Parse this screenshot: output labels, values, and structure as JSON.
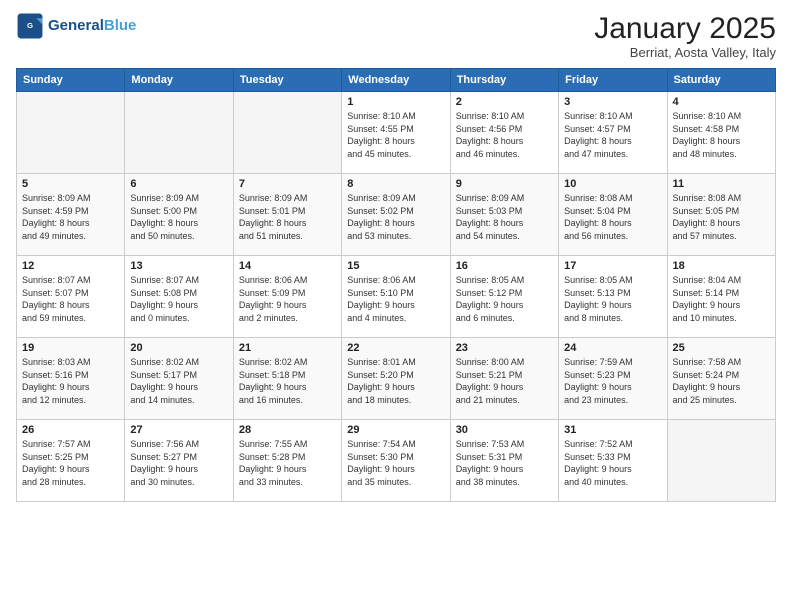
{
  "header": {
    "logo_line1": "General",
    "logo_line2": "Blue",
    "month": "January 2025",
    "location": "Berriat, Aosta Valley, Italy"
  },
  "weekdays": [
    "Sunday",
    "Monday",
    "Tuesday",
    "Wednesday",
    "Thursday",
    "Friday",
    "Saturday"
  ],
  "weeks": [
    [
      {
        "day": "",
        "info": ""
      },
      {
        "day": "",
        "info": ""
      },
      {
        "day": "",
        "info": ""
      },
      {
        "day": "1",
        "info": "Sunrise: 8:10 AM\nSunset: 4:55 PM\nDaylight: 8 hours\nand 45 minutes."
      },
      {
        "day": "2",
        "info": "Sunrise: 8:10 AM\nSunset: 4:56 PM\nDaylight: 8 hours\nand 46 minutes."
      },
      {
        "day": "3",
        "info": "Sunrise: 8:10 AM\nSunset: 4:57 PM\nDaylight: 8 hours\nand 47 minutes."
      },
      {
        "day": "4",
        "info": "Sunrise: 8:10 AM\nSunset: 4:58 PM\nDaylight: 8 hours\nand 48 minutes."
      }
    ],
    [
      {
        "day": "5",
        "info": "Sunrise: 8:09 AM\nSunset: 4:59 PM\nDaylight: 8 hours\nand 49 minutes."
      },
      {
        "day": "6",
        "info": "Sunrise: 8:09 AM\nSunset: 5:00 PM\nDaylight: 8 hours\nand 50 minutes."
      },
      {
        "day": "7",
        "info": "Sunrise: 8:09 AM\nSunset: 5:01 PM\nDaylight: 8 hours\nand 51 minutes."
      },
      {
        "day": "8",
        "info": "Sunrise: 8:09 AM\nSunset: 5:02 PM\nDaylight: 8 hours\nand 53 minutes."
      },
      {
        "day": "9",
        "info": "Sunrise: 8:09 AM\nSunset: 5:03 PM\nDaylight: 8 hours\nand 54 minutes."
      },
      {
        "day": "10",
        "info": "Sunrise: 8:08 AM\nSunset: 5:04 PM\nDaylight: 8 hours\nand 56 minutes."
      },
      {
        "day": "11",
        "info": "Sunrise: 8:08 AM\nSunset: 5:05 PM\nDaylight: 8 hours\nand 57 minutes."
      }
    ],
    [
      {
        "day": "12",
        "info": "Sunrise: 8:07 AM\nSunset: 5:07 PM\nDaylight: 8 hours\nand 59 minutes."
      },
      {
        "day": "13",
        "info": "Sunrise: 8:07 AM\nSunset: 5:08 PM\nDaylight: 9 hours\nand 0 minutes."
      },
      {
        "day": "14",
        "info": "Sunrise: 8:06 AM\nSunset: 5:09 PM\nDaylight: 9 hours\nand 2 minutes."
      },
      {
        "day": "15",
        "info": "Sunrise: 8:06 AM\nSunset: 5:10 PM\nDaylight: 9 hours\nand 4 minutes."
      },
      {
        "day": "16",
        "info": "Sunrise: 8:05 AM\nSunset: 5:12 PM\nDaylight: 9 hours\nand 6 minutes."
      },
      {
        "day": "17",
        "info": "Sunrise: 8:05 AM\nSunset: 5:13 PM\nDaylight: 9 hours\nand 8 minutes."
      },
      {
        "day": "18",
        "info": "Sunrise: 8:04 AM\nSunset: 5:14 PM\nDaylight: 9 hours\nand 10 minutes."
      }
    ],
    [
      {
        "day": "19",
        "info": "Sunrise: 8:03 AM\nSunset: 5:16 PM\nDaylight: 9 hours\nand 12 minutes."
      },
      {
        "day": "20",
        "info": "Sunrise: 8:02 AM\nSunset: 5:17 PM\nDaylight: 9 hours\nand 14 minutes."
      },
      {
        "day": "21",
        "info": "Sunrise: 8:02 AM\nSunset: 5:18 PM\nDaylight: 9 hours\nand 16 minutes."
      },
      {
        "day": "22",
        "info": "Sunrise: 8:01 AM\nSunset: 5:20 PM\nDaylight: 9 hours\nand 18 minutes."
      },
      {
        "day": "23",
        "info": "Sunrise: 8:00 AM\nSunset: 5:21 PM\nDaylight: 9 hours\nand 21 minutes."
      },
      {
        "day": "24",
        "info": "Sunrise: 7:59 AM\nSunset: 5:23 PM\nDaylight: 9 hours\nand 23 minutes."
      },
      {
        "day": "25",
        "info": "Sunrise: 7:58 AM\nSunset: 5:24 PM\nDaylight: 9 hours\nand 25 minutes."
      }
    ],
    [
      {
        "day": "26",
        "info": "Sunrise: 7:57 AM\nSunset: 5:25 PM\nDaylight: 9 hours\nand 28 minutes."
      },
      {
        "day": "27",
        "info": "Sunrise: 7:56 AM\nSunset: 5:27 PM\nDaylight: 9 hours\nand 30 minutes."
      },
      {
        "day": "28",
        "info": "Sunrise: 7:55 AM\nSunset: 5:28 PM\nDaylight: 9 hours\nand 33 minutes."
      },
      {
        "day": "29",
        "info": "Sunrise: 7:54 AM\nSunset: 5:30 PM\nDaylight: 9 hours\nand 35 minutes."
      },
      {
        "day": "30",
        "info": "Sunrise: 7:53 AM\nSunset: 5:31 PM\nDaylight: 9 hours\nand 38 minutes."
      },
      {
        "day": "31",
        "info": "Sunrise: 7:52 AM\nSunset: 5:33 PM\nDaylight: 9 hours\nand 40 minutes."
      },
      {
        "day": "",
        "info": ""
      }
    ]
  ]
}
